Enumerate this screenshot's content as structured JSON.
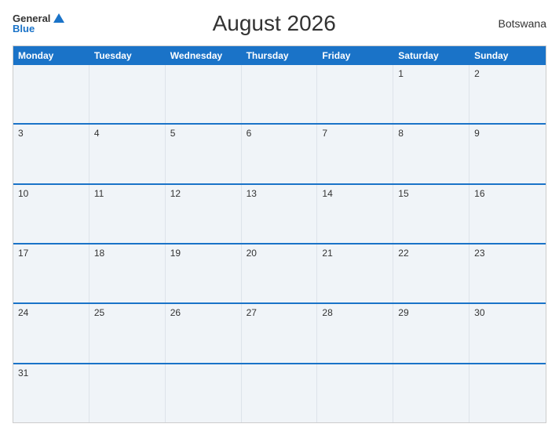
{
  "header": {
    "title": "August 2026",
    "country": "Botswana",
    "logo_general": "General",
    "logo_blue": "Blue"
  },
  "weekdays": [
    "Monday",
    "Tuesday",
    "Wednesday",
    "Thursday",
    "Friday",
    "Saturday",
    "Sunday"
  ],
  "weeks": [
    [
      {
        "day": "",
        "empty": true
      },
      {
        "day": "",
        "empty": true
      },
      {
        "day": "",
        "empty": true
      },
      {
        "day": "",
        "empty": true
      },
      {
        "day": "",
        "empty": true
      },
      {
        "day": "1"
      },
      {
        "day": "2"
      }
    ],
    [
      {
        "day": "3"
      },
      {
        "day": "4"
      },
      {
        "day": "5"
      },
      {
        "day": "6"
      },
      {
        "day": "7"
      },
      {
        "day": "8"
      },
      {
        "day": "9"
      }
    ],
    [
      {
        "day": "10"
      },
      {
        "day": "11"
      },
      {
        "day": "12"
      },
      {
        "day": "13"
      },
      {
        "day": "14"
      },
      {
        "day": "15"
      },
      {
        "day": "16"
      }
    ],
    [
      {
        "day": "17"
      },
      {
        "day": "18"
      },
      {
        "day": "19"
      },
      {
        "day": "20"
      },
      {
        "day": "21"
      },
      {
        "day": "22"
      },
      {
        "day": "23"
      }
    ],
    [
      {
        "day": "24"
      },
      {
        "day": "25"
      },
      {
        "day": "26"
      },
      {
        "day": "27"
      },
      {
        "day": "28"
      },
      {
        "day": "29"
      },
      {
        "day": "30"
      }
    ],
    [
      {
        "day": "31"
      },
      {
        "day": "",
        "empty": true
      },
      {
        "day": "",
        "empty": true
      },
      {
        "day": "",
        "empty": true
      },
      {
        "day": "",
        "empty": true
      },
      {
        "day": "",
        "empty": true
      },
      {
        "day": "",
        "empty": true
      }
    ]
  ]
}
